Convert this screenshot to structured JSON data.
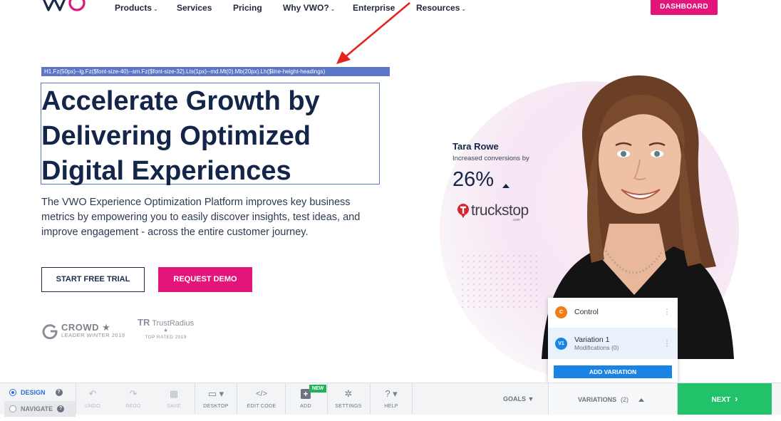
{
  "nav": {
    "logo_text": "VWO",
    "links": [
      {
        "label": "Products",
        "has_dropdown": true
      },
      {
        "label": "Services",
        "has_dropdown": false
      },
      {
        "label": "Pricing",
        "has_dropdown": false
      },
      {
        "label": "Why VWO?",
        "has_dropdown": true
      },
      {
        "label": "Enterprise",
        "has_dropdown": false
      },
      {
        "label": "Resources",
        "has_dropdown": true
      }
    ],
    "dashboard_label": "DASHBOARD",
    "chevron": "⌄"
  },
  "inspector": {
    "selector": "H1.Fz(50px)--lg.Fz($font-size-40)--sm.Fz($font-size-32).Lts(1px)--md.Mt(0).Mb(20px).Lh($line-height-headings)"
  },
  "hero": {
    "title_lines": [
      "Accelerate Growth by",
      "Delivering Optimized",
      "Digital Experiences"
    ],
    "subtitle": "The VWO Experience Optimization Platform improves key business metrics by empowering you to easily discover insights, test ideas, and improve engagement - across the entire customer journey.",
    "cta_trial": "START FREE TRIAL",
    "cta_demo": "REQUEST DEMO"
  },
  "badges": {
    "g2_title": "CROWD",
    "g2_star": "★",
    "g2_sub": "LEADER WINTER 2019",
    "tr_title": "TrustRadius",
    "tr_stars": "★",
    "tr_sub": "TOP RATED 2019"
  },
  "testimonial": {
    "name": "Tara Rowe",
    "desc": "Increased conversions by",
    "percent": "26%",
    "company": "truckstop",
    "company_suffix": ".com"
  },
  "variations_panel": {
    "items": [
      {
        "badge": "C",
        "label": "Control",
        "sub": "",
        "color": "#f07c1a"
      },
      {
        "badge": "V1",
        "label": "Variation 1",
        "sub": "Modifications (0)",
        "color": "#1a84e4"
      }
    ],
    "add_label": "ADD VARIATION",
    "kebab": "⋮"
  },
  "toolbar": {
    "design_label": "DESIGN",
    "navigate_label": "NAVIGATE",
    "help_glyph": "?",
    "tools": [
      {
        "name": "undo",
        "label": "UNDO",
        "icon": "↶"
      },
      {
        "name": "redo",
        "label": "REDO",
        "icon": "↷"
      },
      {
        "name": "save",
        "label": "SAVE",
        "icon": "▦"
      },
      {
        "name": "desktop",
        "label": "DESKTOP",
        "icon": "▭ ▾"
      },
      {
        "name": "edit-code",
        "label": "EDIT CODE",
        "icon": "</>"
      },
      {
        "name": "add",
        "label": "ADD",
        "icon": "+"
      },
      {
        "name": "settings",
        "label": "SETTINGS",
        "icon": "✲"
      },
      {
        "name": "help",
        "label": "HELP",
        "icon": "? ▾"
      }
    ],
    "new_badge": "NEW",
    "goals_label": "GOALS ▼",
    "variations_label": "VARIATIONS",
    "variations_count": "(2)",
    "next_label": "NEXT",
    "next_chevron": "›"
  },
  "colors": {
    "brand_pink": "#e4157a",
    "navy": "#14254a",
    "blue": "#1a84e4",
    "green": "#21c26a",
    "inspector_blue": "#5b76c8"
  }
}
